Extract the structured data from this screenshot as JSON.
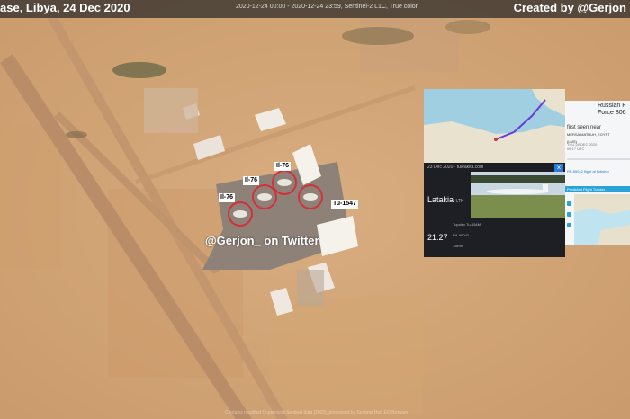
{
  "header": {
    "title": "ase, Libya, 24 Dec 2020",
    "acquisition": "2020-12-24 00:00 - 2020-12-24 23:59, Sentinel-2 L1C, True color",
    "credit": "Created by @Gerjon"
  },
  "aircraft_labels": [
    "Il-76",
    "Il-76",
    "Il-76",
    "Tu-1547"
  ],
  "overlay_text": "@Gerjon_ on Twitter",
  "flight_tracker": {
    "date": "23 Dec 2020 · tuleakita.com",
    "close_icon": "close-icon",
    "origin_city": "Latakia",
    "origin_code": "LTK",
    "departure_time": "21:27",
    "aircraft_model": "Tupolev Tu-154M",
    "registration": "RA-85042",
    "serial": "1AR99"
  },
  "sighting_panel": {
    "title_line1": "Russian F",
    "title_line2": "Force 806",
    "seen_line1": "first seen near",
    "seen_line2": "MERSA MATRUH, EGYPT",
    "seen_line3": "(LMS)",
    "seen_time": "THU 24 DEC 2020",
    "seen_time2": "05:17 UTC",
    "flight_link": "RF-85042 flight at fsdisher",
    "band_label": "Predicted Flight Tracker"
  },
  "footer_text": "Contains modified Copernicus Sentinel data [2020], processed by Sentinel Hub EO Browser"
}
